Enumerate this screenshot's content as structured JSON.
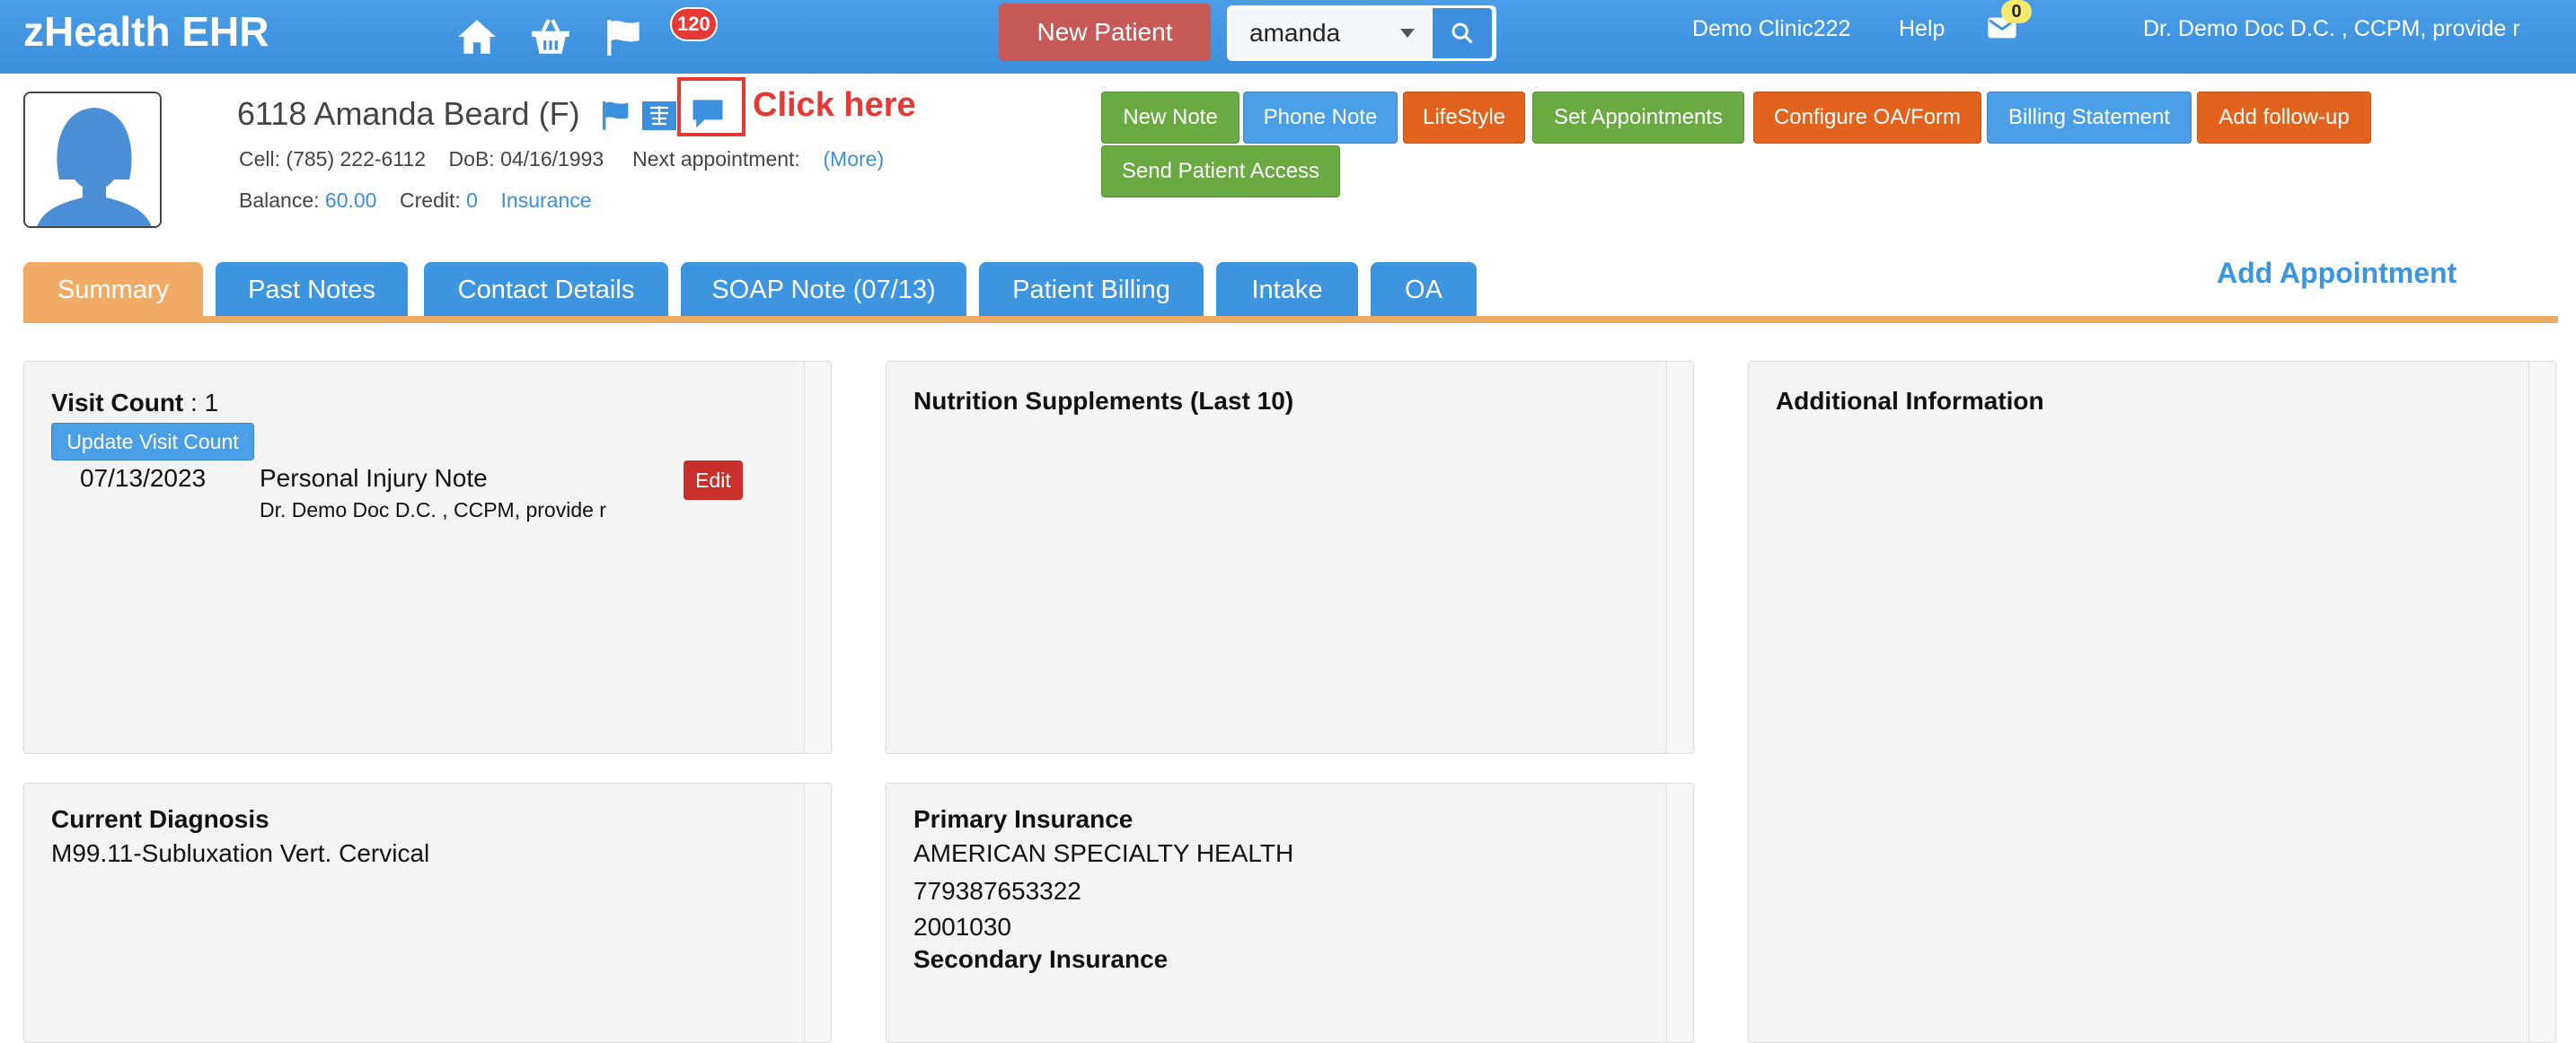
{
  "navbar": {
    "brand": "zHealth EHR",
    "notification_count": "120",
    "new_patient_label": "New Patient",
    "search_value": "amanda",
    "clinic": "Demo Clinic222",
    "help": "Help",
    "mail_count": "0",
    "user": "Dr. Demo Doc D.C. , CCPM, provide r",
    "color": "#3b8fdc"
  },
  "patient": {
    "name": "6118 Amanda Beard (F)",
    "callout": "Click here",
    "cell_label": "Cell:",
    "cell": "(785) 222-6112",
    "dob_label": "DoB:",
    "dob": "04/16/1993",
    "next_appt_label": "Next appointment:",
    "more": "(More)",
    "balance_label": "Balance:",
    "balance": "60.00",
    "credit_label": "Credit:",
    "credit": "0",
    "insurance": "Insurance"
  },
  "actions": {
    "new_note": "New Note",
    "phone_note": "Phone Note",
    "lifestyle": "LifeStyle",
    "set_appointments": "Set Appointments",
    "configure_oa": "Configure OA/Form",
    "billing_statement": "Billing Statement",
    "add_followup": "Add follow-up",
    "send_access": "Send Patient Access"
  },
  "tabs": {
    "summary": "Summary",
    "past_notes": "Past Notes",
    "contact": "Contact Details",
    "soap": "SOAP Note (07/13)",
    "billing": "Patient Billing",
    "intake": "Intake",
    "oa": "OA",
    "add_appointment": "Add Appointment",
    "active_color": "#f0ac67",
    "tab_color": "#3d95e0"
  },
  "visits": {
    "label": "Visit Count",
    "sep": " : 1",
    "update_label": "Update Visit Count",
    "date": "07/13/2023",
    "note": "Personal Injury Note",
    "doctor": "Dr. Demo Doc D.C. , CCPM, provide r",
    "edit": "Edit"
  },
  "nutrition": {
    "title": "Nutrition Supplements (Last 10)"
  },
  "additional": {
    "title": "Additional Information"
  },
  "diagnosis": {
    "title": "Current Diagnosis",
    "code": "M99.11-Subluxation Vert. Cervical"
  },
  "insurance_panel": {
    "primary_title": "Primary Insurance",
    "name": "AMERICAN SPECIALTY HEALTH",
    "member_id": "779387653322",
    "group": "2001030",
    "secondary_title": "Secondary Insurance"
  }
}
